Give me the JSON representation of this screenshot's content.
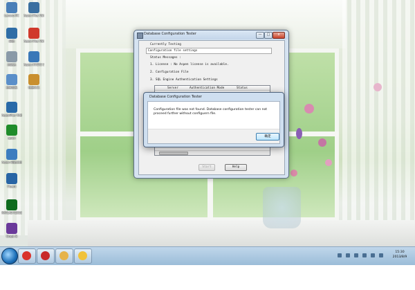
{
  "desktop": {
    "icons": [
      {
        "label": "Lenovo-PC",
        "color": "#4a7fb8"
      },
      {
        "label": "Aspen Plus V8.0",
        "color": "#3a6fa0"
      },
      {
        "label": "网络",
        "color": "#2f6da6"
      },
      {
        "label": "Aspen Plus V8.0 Guide",
        "color": "#d03a2c"
      },
      {
        "label": "回收站",
        "color": "#8a9aa8"
      },
      {
        "label": "Aspen HYSYS V8.0",
        "color": "#3a78b8"
      },
      {
        "label": "控制面板",
        "color": "#5a8fc9"
      },
      {
        "label": "快捷方式",
        "color": "#c98f2e"
      },
      {
        "label": "AspenPlus 中文版",
        "color": "#2a6aa8"
      },
      {
        "label": "apwn",
        "color": "#1f8c2a"
      },
      {
        "label": "Aspen 帮助文档",
        "color": "#3c7dbf"
      },
      {
        "label": "Fluent",
        "color": "#2865a5"
      },
      {
        "label": "MATLAB R2010b",
        "color": "#0f6b1e"
      },
      {
        "label": "Origin 8",
        "color": "#6a3a9a"
      }
    ]
  },
  "main_dialog": {
    "title": "Database Configuration Tester",
    "minimize_label": "—",
    "maximize_label": "□",
    "close_label": "x",
    "currently_testing_label": "Currently Testing",
    "currently_testing_value": "Configuration file settings",
    "status_messages_label": "Status Messages :",
    "line1": "1. License : No Aspen license is available.",
    "line2": "2. Configuration File",
    "line3": "3. SQL Engine Authentication Settings",
    "col_server": "Server",
    "col_auth_mode": "Authentication Mode",
    "col_status": "Status",
    "start_button": "Start",
    "help_button": "Help"
  },
  "error_dialog": {
    "title": "Database Configuration Tester",
    "message": "Configuration file was not found. Database configuration tester can not proceed further without configuern file.",
    "ok_button": "确定"
  },
  "taskbar": {
    "time": "15:30",
    "date": "2013/8/9",
    "pinned": [
      {
        "name": "chrome",
        "color": "#d9322c"
      },
      {
        "name": "acrobat",
        "color": "#c8282a"
      },
      {
        "name": "explorer",
        "color": "#e6b34a"
      },
      {
        "name": "app",
        "color": "#f0c23a"
      }
    ]
  }
}
